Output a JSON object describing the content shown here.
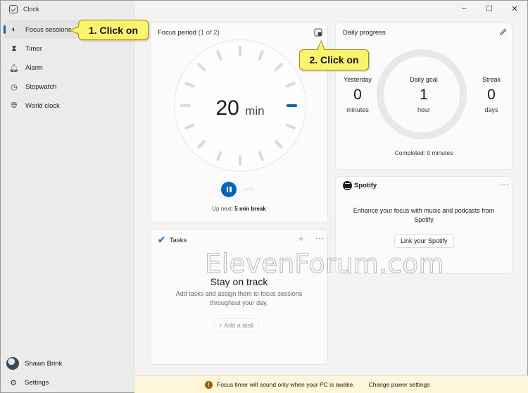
{
  "app": {
    "title": "Clock"
  },
  "window_controls": {
    "minimize": "–",
    "maximize": "☐",
    "close": "✕"
  },
  "sidebar": {
    "items": [
      {
        "label": "Focus sessions",
        "icon": "focus-icon",
        "active": true
      },
      {
        "label": "Timer",
        "icon": "hourglass-icon",
        "active": false
      },
      {
        "label": "Alarm",
        "icon": "bell-icon",
        "active": false
      },
      {
        "label": "Stopwatch",
        "icon": "stopwatch-icon",
        "active": false
      },
      {
        "label": "World clock",
        "icon": "globe-icon",
        "active": false
      }
    ],
    "user": "Shawn Brink",
    "settings": "Settings"
  },
  "focus": {
    "title": "Focus period",
    "count": "(1 of 2)",
    "value": "20",
    "unit": "min",
    "more": "···",
    "upnext_label": "Up next:",
    "upnext_value": "5 min break",
    "progress_accent": "#0067c0"
  },
  "daily": {
    "title": "Daily progress",
    "yesterday": {
      "label": "Yesterday",
      "value": "0",
      "unit": "minutes"
    },
    "goal": {
      "label": "Daily goal",
      "value": "1",
      "unit": "hour"
    },
    "streak": {
      "label": "Streak",
      "value": "0",
      "unit": "days"
    },
    "completed": "Completed: 0 minutes"
  },
  "spotify": {
    "title": "Spotify",
    "more": "···",
    "text": "Enhance your focus with music and podcasts from Spotify",
    "button": "Link your Spotify"
  },
  "tasks": {
    "title": "Tasks",
    "add_icon": "+",
    "more": "···",
    "heading": "Stay on track",
    "sub": "Add tasks and assign them to focus sessions throughout your day.",
    "add_task": "+  Add a task"
  },
  "infobar": {
    "icon": "!",
    "message": "Focus timer will sound only when your PC is awake.",
    "link": "Change power settings"
  },
  "callouts": {
    "one": "1. Click on",
    "two": "2. Click on"
  },
  "watermark": "ElevenForum.com"
}
